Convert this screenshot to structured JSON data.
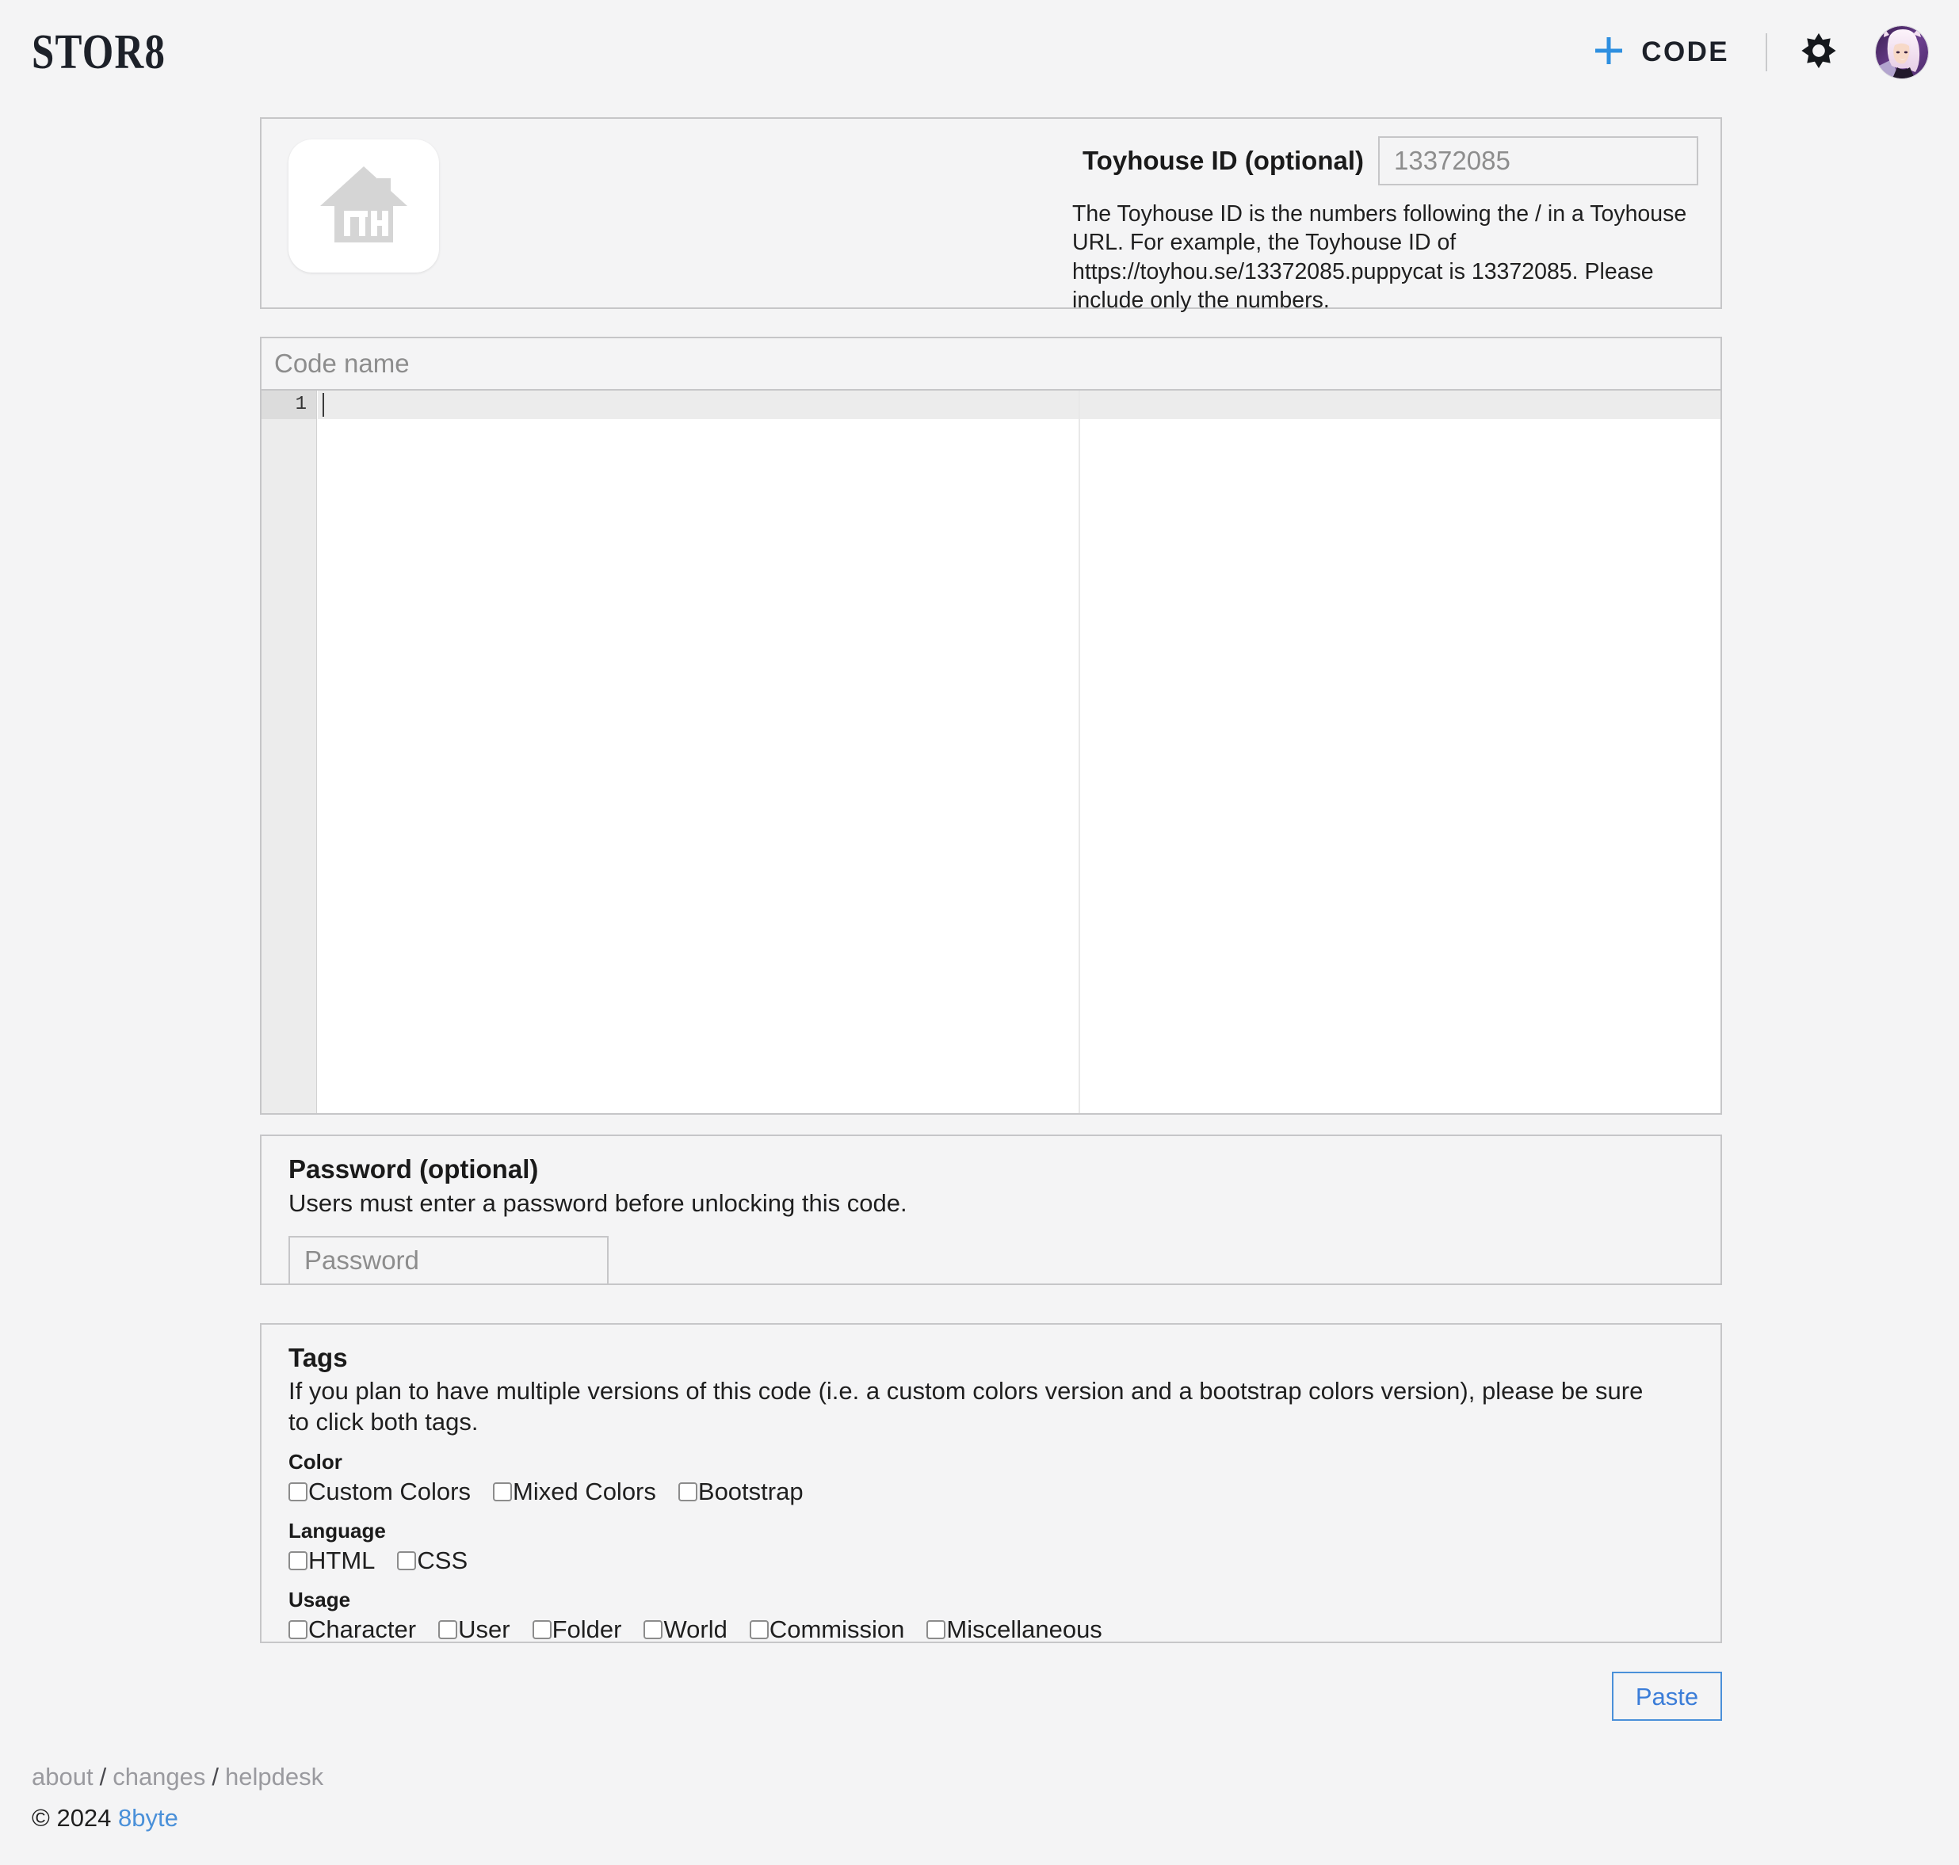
{
  "header": {
    "brand": "STOR8",
    "new_code_label": "CODE",
    "plus_icon": "plus-icon",
    "gear_icon": "gear-icon",
    "avatar_icon": "user-avatar",
    "accent_blue": "#2e8fe0"
  },
  "toyhouse": {
    "logo_icon": "toyhouse-house-icon",
    "id_label": "Toyhouse ID (optional)",
    "id_placeholder": "13372085",
    "id_value": "",
    "help_text": "The Toyhouse ID is the numbers following the / in a Toyhouse URL. For example, the Toyhouse ID of https://toyhou.se/13372085.puppycat is 13372085. Please include only the numbers."
  },
  "code": {
    "name_placeholder": "Code name",
    "name_value": "",
    "editor_content": "",
    "line_numbers": [
      "1"
    ]
  },
  "password": {
    "title": "Password (optional)",
    "description": "Users must enter a password before unlocking this code.",
    "placeholder": "Password",
    "value": ""
  },
  "tags": {
    "title": "Tags",
    "description": "If you plan to have multiple versions of this code (i.e. a custom colors version and a bootstrap colors version), please be sure to click both tags.",
    "groups": [
      {
        "label": "Color",
        "options": [
          {
            "label": "Custom Colors",
            "checked": false
          },
          {
            "label": "Mixed Colors",
            "checked": false
          },
          {
            "label": "Bootstrap",
            "checked": false
          }
        ]
      },
      {
        "label": "Language",
        "options": [
          {
            "label": "HTML",
            "checked": false
          },
          {
            "label": "CSS",
            "checked": false
          }
        ]
      },
      {
        "label": "Usage",
        "options": [
          {
            "label": "Character",
            "checked": false
          },
          {
            "label": "User",
            "checked": false
          },
          {
            "label": "Folder",
            "checked": false
          },
          {
            "label": "World",
            "checked": false
          },
          {
            "label": "Commission",
            "checked": false
          },
          {
            "label": "Miscellaneous",
            "checked": false
          }
        ]
      }
    ]
  },
  "actions": {
    "paste_label": "Paste"
  },
  "footer": {
    "links": [
      {
        "label": "about"
      },
      {
        "label": "changes"
      },
      {
        "label": "helpdesk"
      }
    ],
    "separator": "/",
    "copyright_prefix": "© 2024",
    "copyright_link": "8byte"
  }
}
